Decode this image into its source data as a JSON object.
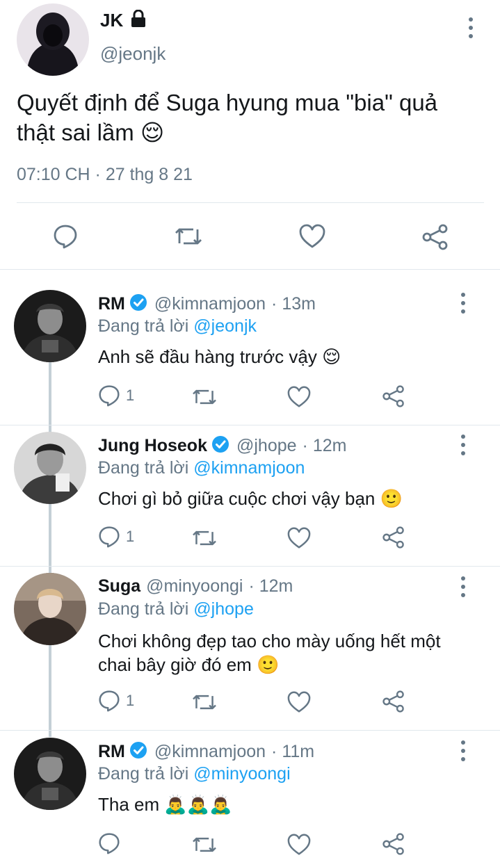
{
  "main_tweet": {
    "author_name": "JK",
    "handle": "@jeonjk",
    "text": "Quyết định để Suga hyung mua \"bia\" quả thật sai lầm 😌",
    "timestamp": "07:10 CH · 27 thg 8 21",
    "locked_icon": "lock-icon"
  },
  "replies": [
    {
      "name": "RM",
      "verified": true,
      "handle": "@kimnamjoon",
      "time": "· 13m",
      "replying_prefix": "Đang trả lời",
      "replying_to": "@jeonjk",
      "text": "Anh sẽ đầu hàng trước vậy 😌",
      "reply_count": "1"
    },
    {
      "name": "Jung Hoseok",
      "verified": true,
      "handle": "@jhope",
      "time": "· 12m",
      "replying_prefix": "Đang trả lời",
      "replying_to": "@kimnamjoon",
      "text": "Chơi gì bỏ giữa cuộc chơi vậy bạn 🙂",
      "reply_count": "1"
    },
    {
      "name": "Suga",
      "verified": false,
      "handle": "@minyoongi",
      "time": "· 12m",
      "replying_prefix": "Đang trả lời",
      "replying_to": "@jhope",
      "text_line1": "Chơi không đẹp tao cho mày uống hết một",
      "text_line2": "chai bây giờ đó em 🙂",
      "reply_count": "1"
    },
    {
      "name": "RM",
      "verified": true,
      "handle": "@kimnamjoon",
      "time": "· 11m",
      "replying_prefix": "Đang trả lời",
      "replying_to": "@minyoongi",
      "text": "Tha em 🙇‍♂️🙇‍♂️🙇‍♂️",
      "reply_count": ""
    }
  ],
  "colors": {
    "accent": "#1da1f2",
    "secondary_text": "#657786",
    "divider": "#e1e8ed"
  }
}
